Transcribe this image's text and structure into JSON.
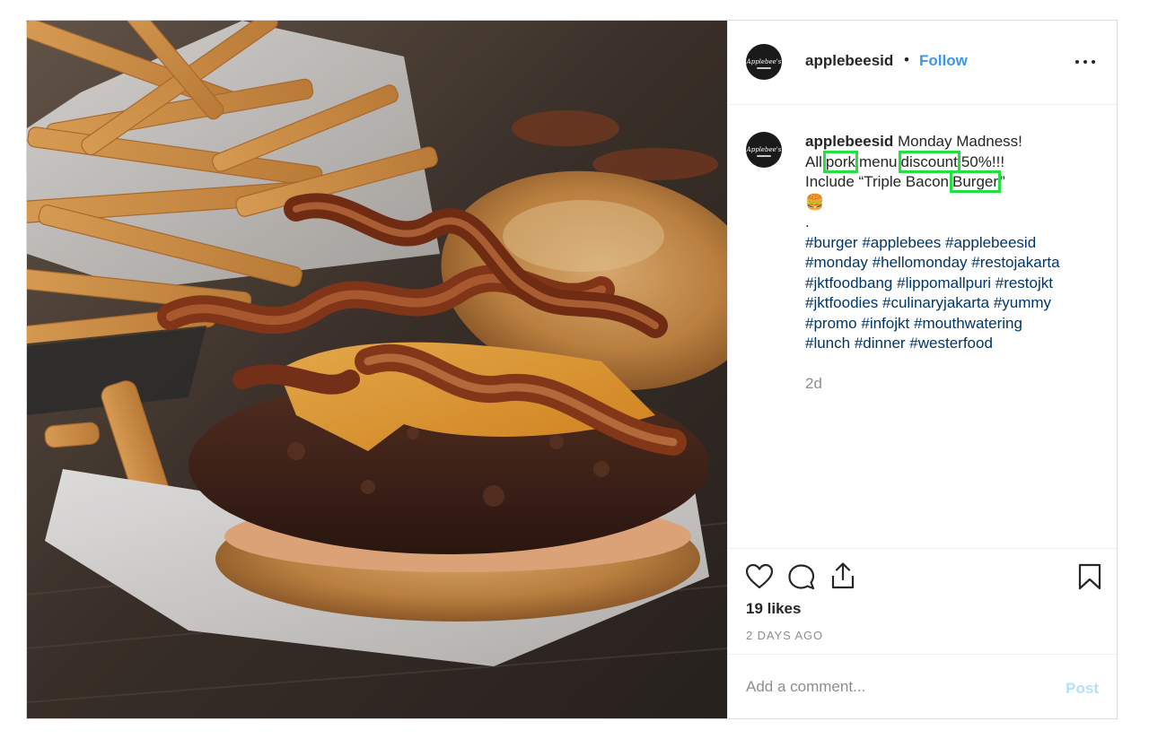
{
  "header": {
    "username": "applebeesid",
    "separator": "•",
    "follow_label": "Follow",
    "avatar_logo_text": "Applebee's",
    "more_icon": "more-horizontal-icon"
  },
  "caption": {
    "username": "applebeesid",
    "line1_rest": "Monday Madness!",
    "line2_prefix": "All",
    "line2_hl1": "pork",
    "line2_mid": "menu",
    "line2_hl2": "discount",
    "line2_suffix": "50%!!!",
    "line3_prefix": "Include “Triple Bacon",
    "line3_hl": "Burger",
    "line3_suffix": "”",
    "line4_emoji": "🍔",
    "line5": ".",
    "hashtags": [
      "#burger",
      "#applebees",
      "#applebeesid",
      "#monday",
      "#hellomonday",
      "#restojakarta",
      "#jktfoodbang",
      "#lippomallpuri",
      "#restojkt",
      "#jktfoodies",
      "#culinaryjakarta",
      "#yummy",
      "#promo",
      "#infojkt",
      "#mouthwatering",
      "#lunch",
      "#dinner",
      "#westerfood"
    ],
    "time": "2d"
  },
  "highlight_color": "#22e042",
  "link_color": "#003569",
  "accent_color": "#3897f0",
  "actions": {
    "icons": [
      "heart-icon",
      "comment-icon",
      "share-icon",
      "bookmark-icon"
    ],
    "likes": "19 likes",
    "date": "2 DAYS AGO"
  },
  "comment": {
    "placeholder": "Add a comment...",
    "post_label": "Post"
  }
}
